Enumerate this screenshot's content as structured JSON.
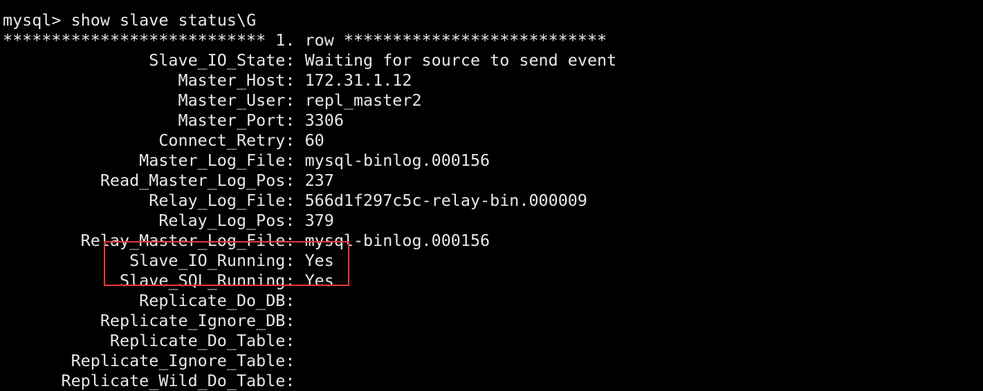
{
  "terminal": {
    "partial_top": "| | |",
    "prompt": "mysql>",
    "command": "show slave status\\G",
    "row_header": "*************************** 1. row ***************************",
    "label_width": 30,
    "fields": [
      {
        "key": "Slave_IO_State",
        "value": "Waiting for source to send event"
      },
      {
        "key": "Master_Host",
        "value": "172.31.1.12"
      },
      {
        "key": "Master_User",
        "value": "repl_master2"
      },
      {
        "key": "Master_Port",
        "value": "3306"
      },
      {
        "key": "Connect_Retry",
        "value": "60"
      },
      {
        "key": "Master_Log_File",
        "value": "mysql-binlog.000156"
      },
      {
        "key": "Read_Master_Log_Pos",
        "value": "237"
      },
      {
        "key": "Relay_Log_File",
        "value": "566d1f297c5c-relay-bin.000009"
      },
      {
        "key": "Relay_Log_Pos",
        "value": "379"
      },
      {
        "key": "Relay_Master_Log_File",
        "value": "mysql-binlog.000156"
      },
      {
        "key": "Slave_IO_Running",
        "value": "Yes",
        "highlighted": true
      },
      {
        "key": "Slave_SQL_Running",
        "value": "Yes",
        "highlighted": true
      },
      {
        "key": "Replicate_Do_DB",
        "value": ""
      },
      {
        "key": "Replicate_Ignore_DB",
        "value": ""
      },
      {
        "key": "Replicate_Do_Table",
        "value": ""
      },
      {
        "key": "Replicate_Ignore_Table",
        "value": ""
      },
      {
        "key": "Replicate_Wild_Do_Table",
        "value": ""
      }
    ]
  },
  "colors": {
    "background": "#000000",
    "text": "#e8e8e8",
    "highlight_border": "#e8383b"
  }
}
